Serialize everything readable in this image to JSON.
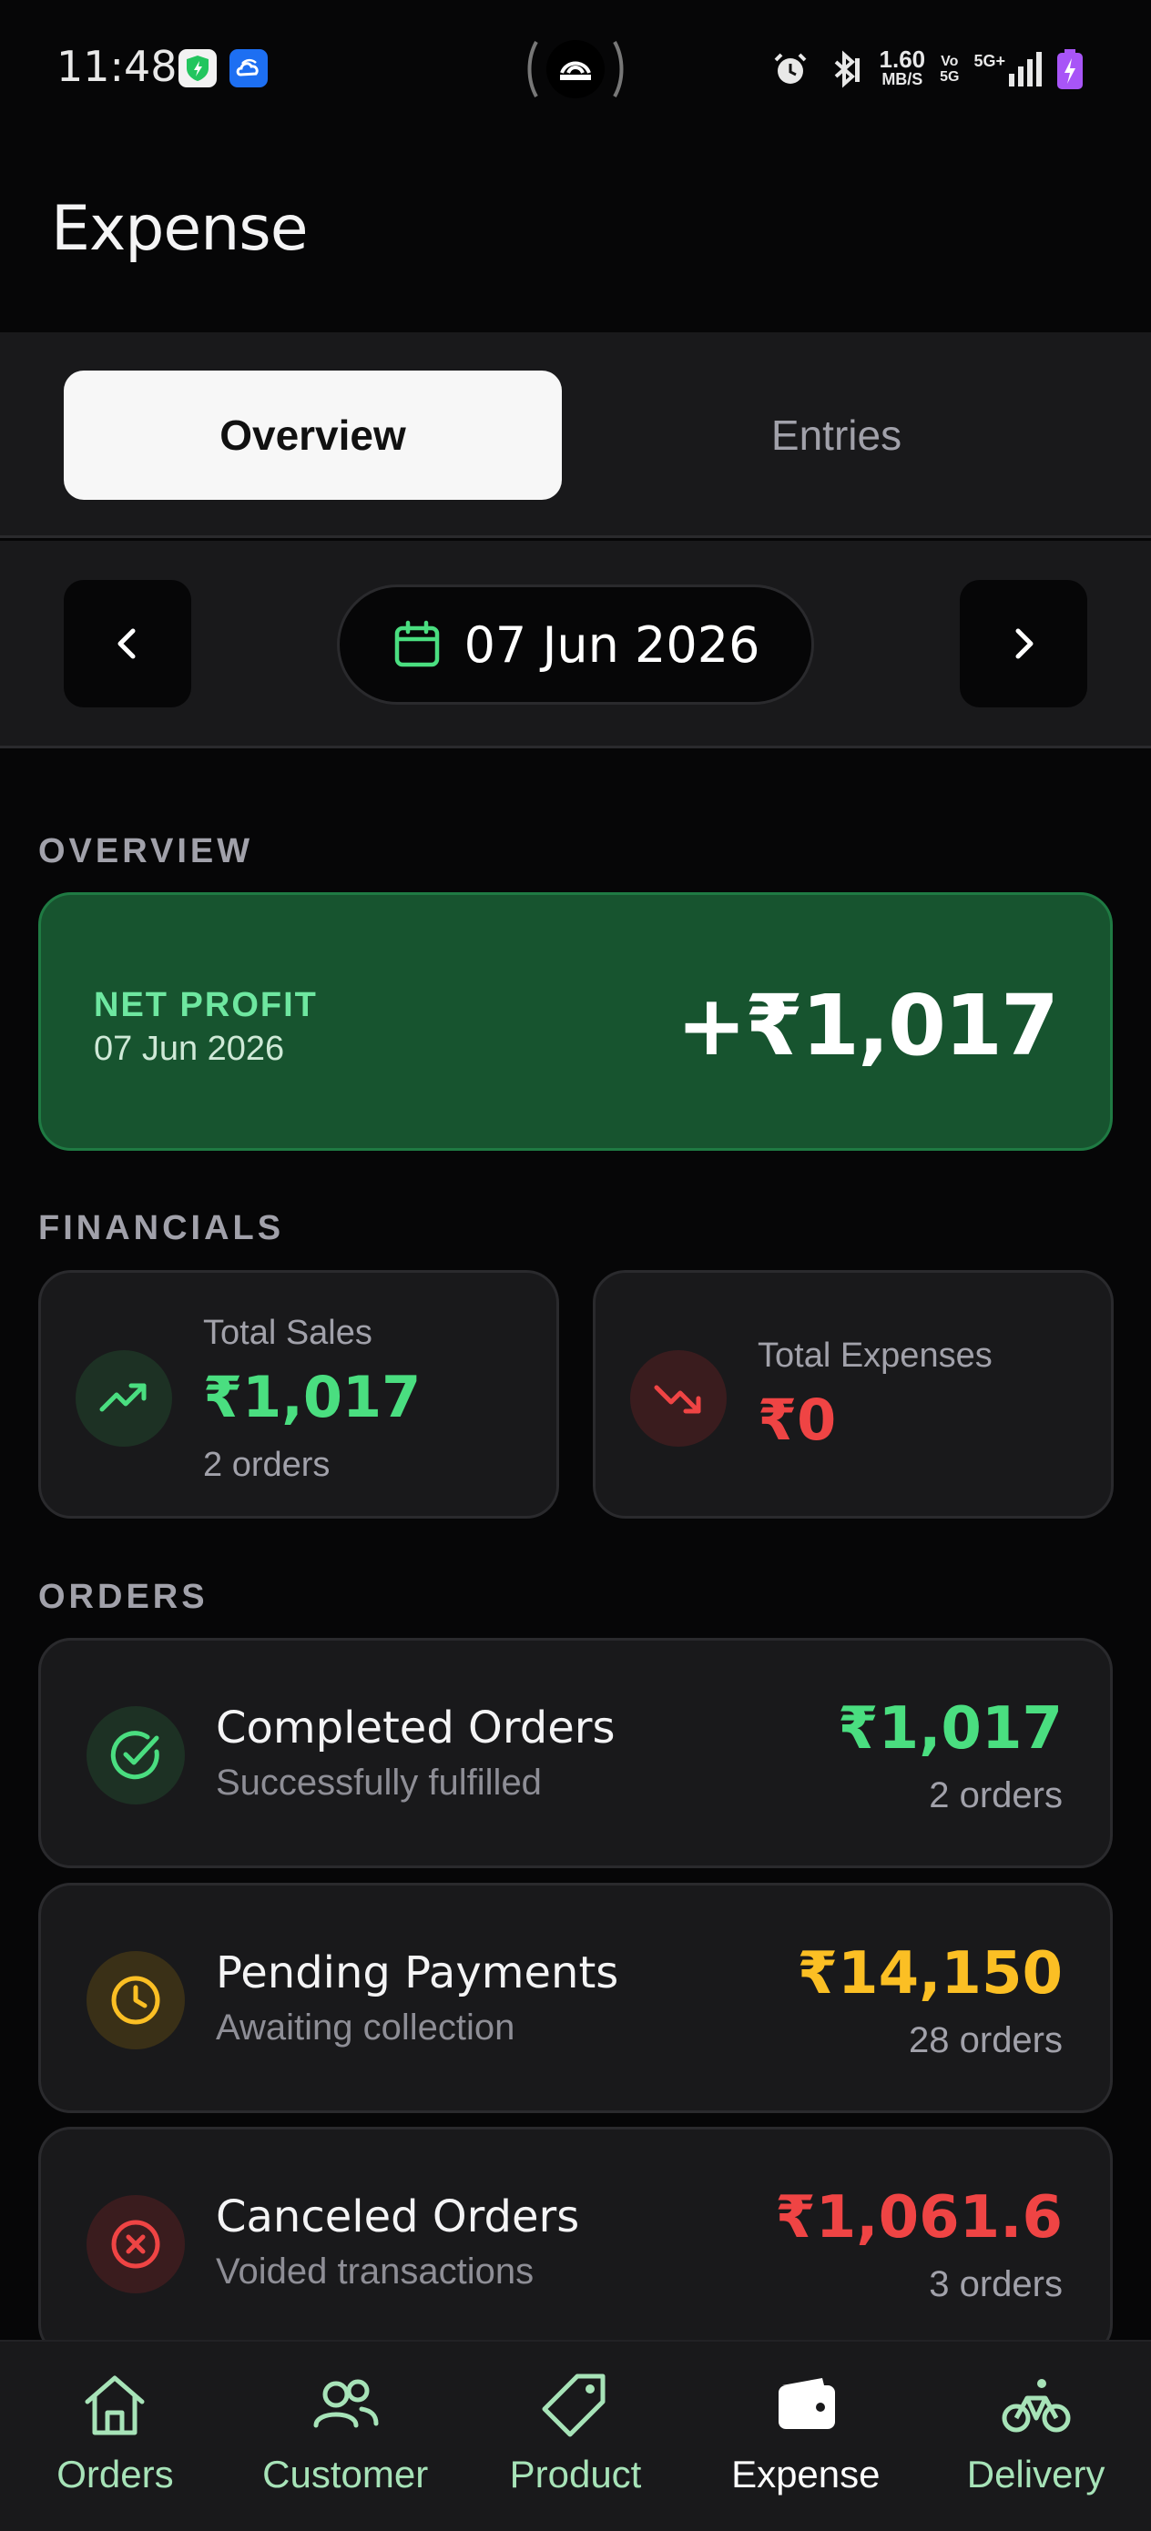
{
  "status_bar": {
    "time": "11:48",
    "speed_value": "1.60",
    "speed_unit": "MB/S",
    "volte_top": "Vo",
    "volte_bottom": "5G",
    "network": "5G+"
  },
  "header": {
    "title": "Expense"
  },
  "tabs": [
    {
      "label": "Overview",
      "active": true
    },
    {
      "label": "Entries",
      "active": false
    }
  ],
  "date_nav": {
    "date": "07 Jun 2026"
  },
  "sections": {
    "overview": "OVERVIEW",
    "financials": "FINANCIALS",
    "orders": "ORDERS"
  },
  "net_profit": {
    "label": "NET PROFIT",
    "date": "07 Jun 2026",
    "value": "+₹1,017"
  },
  "financials": {
    "sales": {
      "title": "Total Sales",
      "amount": "₹1,017",
      "sub": "2 orders"
    },
    "expenses": {
      "title": "Total Expenses",
      "amount": "₹0"
    }
  },
  "orders": [
    {
      "title": "Completed Orders",
      "desc": "Successfully fulfilled",
      "amount": "₹1,017",
      "count": "2 orders"
    },
    {
      "title": "Pending Payments",
      "desc": "Awaiting collection",
      "amount": "₹14,150",
      "count": "28 orders"
    },
    {
      "title": "Canceled Orders",
      "desc": "Voided transactions",
      "amount": "₹1,061.6",
      "count": "3 orders"
    }
  ],
  "bottom_nav": [
    {
      "label": "Orders",
      "icon": "home-icon"
    },
    {
      "label": "Customer",
      "icon": "users-icon"
    },
    {
      "label": "Product",
      "icon": "tag-icon"
    },
    {
      "label": "Expense",
      "icon": "wallet-icon",
      "active": true
    },
    {
      "label": "Delivery",
      "icon": "bicycle-icon"
    }
  ],
  "colors": {
    "accent_green": "#4ade80",
    "profit_card": "#17542f",
    "expense_red": "#ef4444",
    "pending_yellow": "#fbbf24"
  }
}
